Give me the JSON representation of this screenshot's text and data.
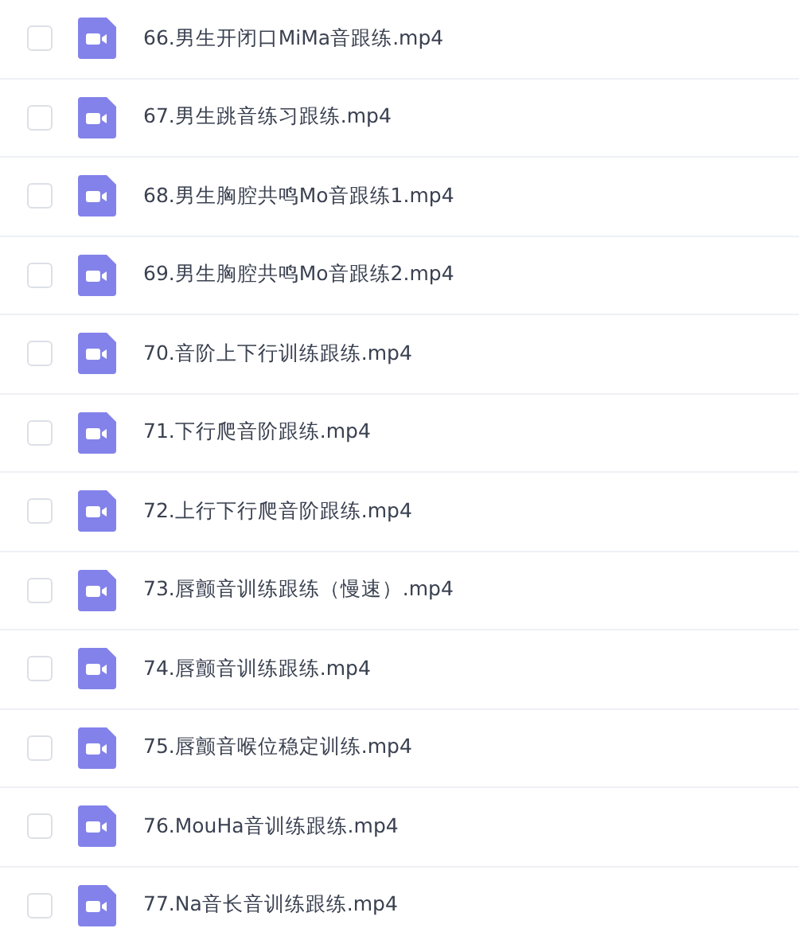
{
  "files": [
    {
      "name": "66.男生开闭口MiMa音跟练.mp4",
      "checked": false
    },
    {
      "name": "67.男生跳音练习跟练.mp4",
      "checked": false
    },
    {
      "name": "68.男生胸腔共鸣Mo音跟练1.mp4",
      "checked": false
    },
    {
      "name": "69.男生胸腔共鸣Mo音跟练2.mp4",
      "checked": false
    },
    {
      "name": "70.音阶上下行训练跟练.mp4",
      "checked": false
    },
    {
      "name": "71.下行爬音阶跟练.mp4",
      "checked": false
    },
    {
      "name": "72.上行下行爬音阶跟练.mp4",
      "checked": false
    },
    {
      "name": "73.唇颤音训练跟练（慢速）.mp4",
      "checked": false
    },
    {
      "name": "74.唇颤音训练跟练.mp4",
      "checked": false
    },
    {
      "name": "75.唇颤音喉位稳定训练.mp4",
      "checked": false
    },
    {
      "name": "76.MouHa音训练跟练.mp4",
      "checked": false
    },
    {
      "name": "77.Na音长音训练跟练.mp4",
      "checked": false
    }
  ]
}
